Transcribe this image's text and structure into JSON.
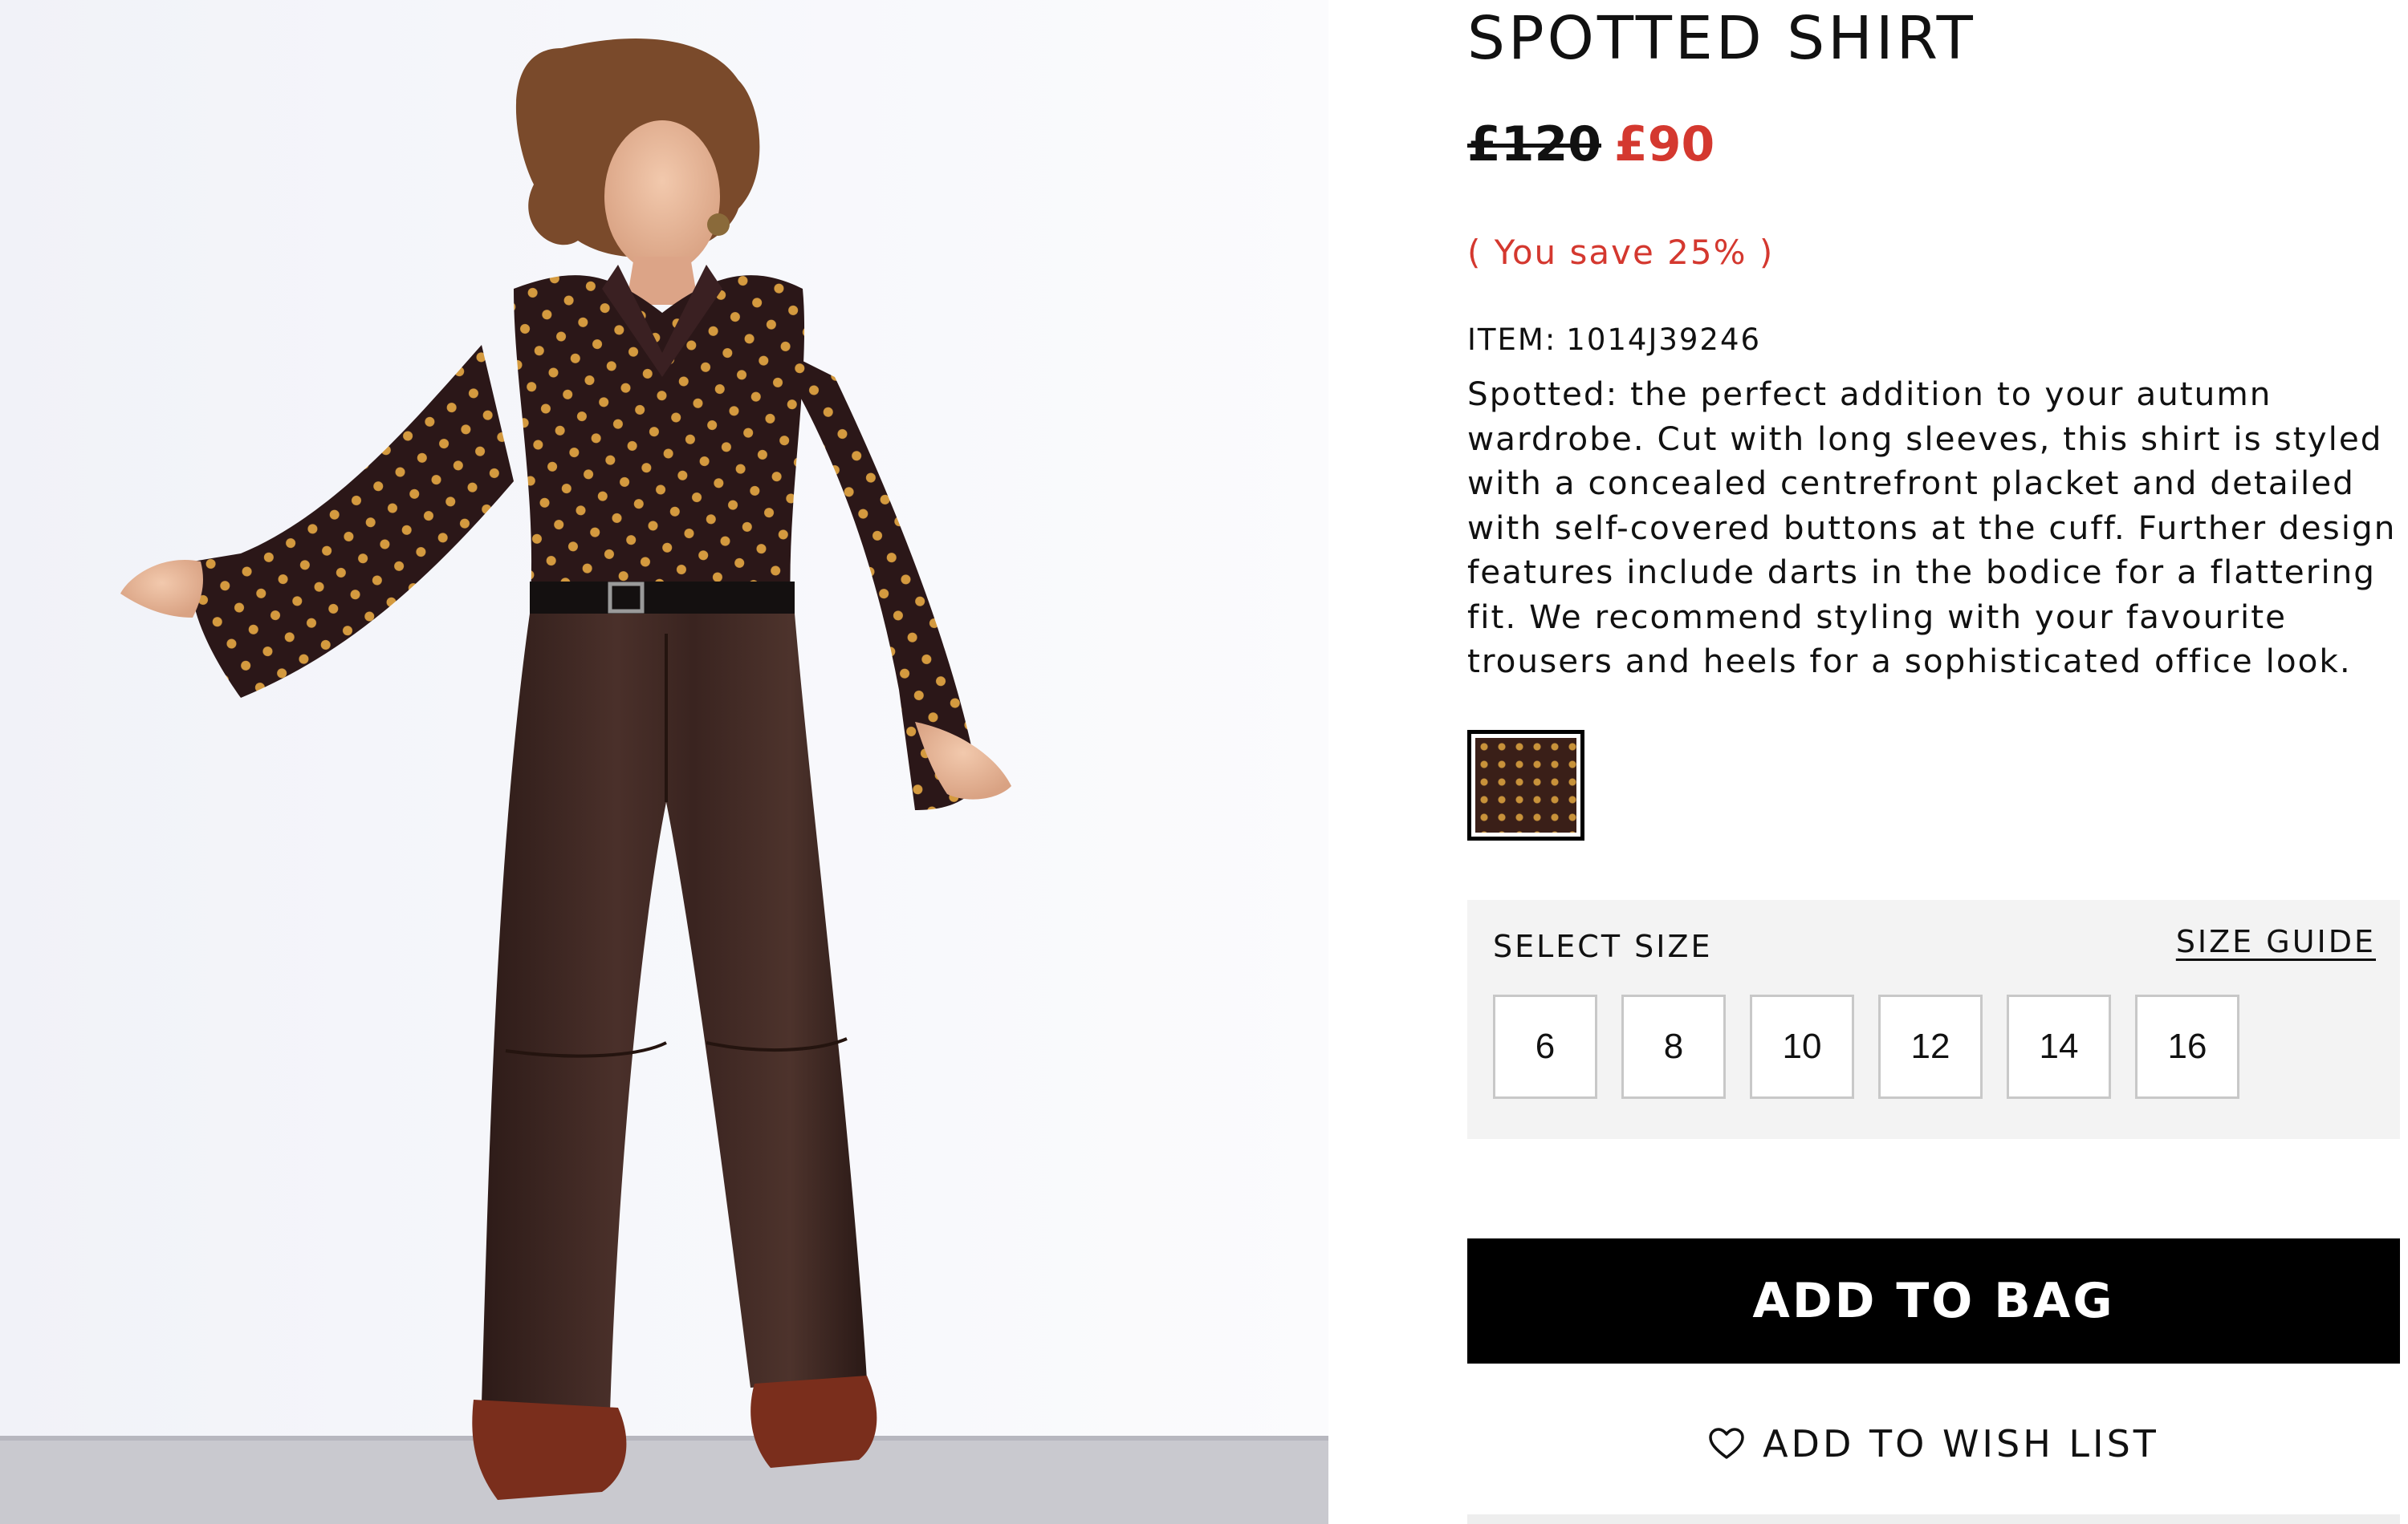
{
  "product": {
    "title": "SPOTTED SHIRT",
    "price_original": "£120",
    "price_sale": "£90",
    "saving": "( You save 25% )",
    "item_label": "ITEM:",
    "item_number": "1014J39246",
    "description": "Spotted: the perfect addition to your autumn wardrobe. Cut with long sleeves, this shirt is styled with a concealed centrefront placket and detailed with self-covered buttons at the cuff. Further design features include darts in the bodice for a flattering fit. We recommend styling with your favourite trousers and heels for a sophisticated office look."
  },
  "size_selector": {
    "label": "SELECT SIZE",
    "guide_label": "SIZE GUIDE",
    "sizes": [
      "6",
      "8",
      "10",
      "12",
      "14",
      "16"
    ]
  },
  "actions": {
    "add_to_bag": "ADD TO BAG",
    "add_to_wish_list": "ADD TO WISH LIST"
  },
  "icons": {
    "wish_list": "heart-outline-icon"
  },
  "colors": {
    "sale_red": "#d4382f",
    "button_black": "#000000",
    "panel_grey": "#f3f3f3",
    "swatch_base": "#3a1f18",
    "swatch_dot": "#c8923a"
  }
}
